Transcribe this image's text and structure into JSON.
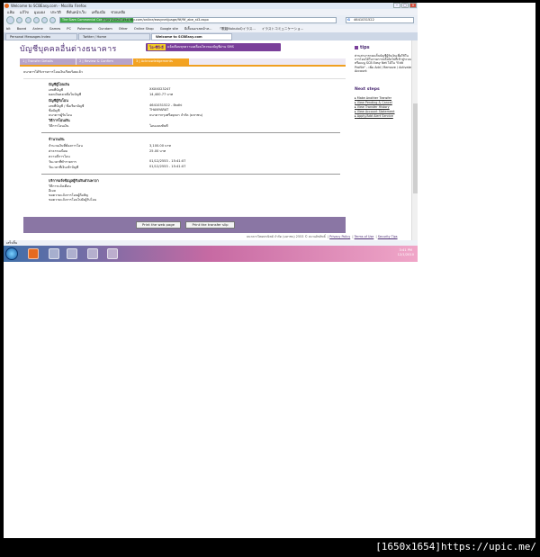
{
  "window": {
    "title": "Welcome to SCBEasy.com - Mozilla Firefox"
  },
  "menu": [
    "แฟ้ม",
    "แก้ไข",
    "มุมมอง",
    "ประวัติ",
    "ที่คั่นหน้าเว็บ",
    "เครื่องมือ",
    "ช่วยเหลือ"
  ],
  "nav": {
    "identity": "The Siam Commercial Company Limited (TH)",
    "url": "https://www.scbeasy.com/online/easynet/page/ftf/ftf_abe_st3.aspx",
    "search": "4641031522"
  },
  "bookmarks": [
    "bit",
    "Board",
    "Anime",
    "Games",
    "PC",
    "Pokemon",
    "Gundam",
    "Other",
    "Online Shop",
    "Google site",
    "ผีเสื้อนอกเขตอ้าห...",
    "「歌姫Nubuluのイラス...",
    "イラストコミュニケーショ..."
  ],
  "tabs": [
    {
      "label": "Personal Messages Index",
      "active": false
    },
    {
      "label": "Twitter / Home",
      "active": false
    },
    {
      "label": "Welcome to SCBEasy.com",
      "active": true
    }
  ],
  "banner": {
    "title": "บัญชีบุคคลอื่นต่างธนาคาร",
    "ad_badge": "ไอ-ซีบี-อี",
    "ad_text": "แจ้งเตือนทุกความเคลื่อนไหวของบัญชีผ่าน SMS"
  },
  "steps": [
    {
      "label": "1  |  Transfer Details",
      "active": false
    },
    {
      "label": "2  |  Review & Confirm",
      "active": false
    },
    {
      "label": "3  |  Acknowledgements",
      "active": true
    }
  ],
  "note": "ธนาคารได้รับรายการโอนเงินเรียบร้อยแล้ว",
  "sections": {
    "from_account": {
      "heading": "บัญชีผู้โอนเงิน",
      "rows": [
        {
          "label": "เลขที่บัญชี",
          "value": "XXXX023247"
        },
        {
          "label": "ยอดเงินคงเหลือในบัญชี",
          "value": "14,400.77 บาท"
        }
      ]
    },
    "to_account": {
      "heading": "บัญชีผู้รับโอน",
      "rows": [
        {
          "label": "เลขที่บัญชี / ชื่อเรียกบัญชี",
          "value": "4641031522 - Bsdhi"
        },
        {
          "label": "ชื่อบัญชี",
          "value": "THANYARAT"
        },
        {
          "label": "ธนาคารผู้รับโอน",
          "value": "ธนาคารกรุงศรีอยุธยา จำกัด (มหาชน)"
        }
      ]
    },
    "method": {
      "heading": "วิธีการโอนเงิน",
      "rows": [
        {
          "label": "วิธีการโอนเงิน",
          "value": "โอนแบบทันที"
        }
      ]
    },
    "amount": {
      "heading": "จำนวนเงิน",
      "rows": [
        {
          "label": "จำนวนเงินที่ต้องการโอน",
          "value": "3,100.00 บาท"
        },
        {
          "label": "ค่าธรรมเนียม",
          "value": "25.00  บาท"
        },
        {
          "label": "ความถี่การโอน",
          "value": ""
        },
        {
          "label": "วันเวลาที่ทำรายการ",
          "value": "01/12/2553 - 15:41:07"
        },
        {
          "label": "วันเวลาที่เงินเข้าบัญชี",
          "value": "01/12/2553 - 15:41:07"
        }
      ]
    },
    "notify": {
      "heading": "บริการแจ้งข้อมูลผู้รับเงินด่วนพาอา",
      "rows": [
        {
          "label": "วิธีการแจ้งเตือน"
        },
        {
          "label": "อีเมล"
        },
        {
          "label": "ขอความแจ้งการโอนผู้ถือสัญ"
        },
        {
          "label": "ขอความแจ้งการโอนไปยังผู้รับโอน"
        }
      ]
    }
  },
  "buttons": {
    "print_page": "Print the web page",
    "print_slip": "Print the transfer slip"
  },
  "footer": {
    "copyright": "ธนาคารไทยพาณิชย์ จำกัด (มหาชน) 2553 © สงวนลิขสิทธิ์",
    "privacy": "Privacy Policy",
    "terms": "Terms of Use",
    "security": "Security Tips"
  },
  "sidebar": {
    "tips_heading": "tips",
    "tips_text": "ท่านสามารถจดเก็บบัญชีผู้รับเงินเพื่อใช้ในการโอนได้ในรายการครั้งถัดไปที่เข้าสู่ระบบ หรือเมนู SCB Easy Net ได้ใน \"Edit Profile\" - เพิ่ม Add / Remove / Activate Account",
    "next_heading": "Next steps",
    "links": [
      "Make Another Transfer",
      "View Pending & Cancel",
      "View Transfer History",
      "View Account Statement",
      "Apply/Add Alert Service"
    ]
  },
  "statusbar": "เสร็จสิ้น",
  "taskbar": {
    "time": "3:41 PM",
    "date": "12/1/2010"
  },
  "watermark": "[1650x1654]https://upic.me/"
}
